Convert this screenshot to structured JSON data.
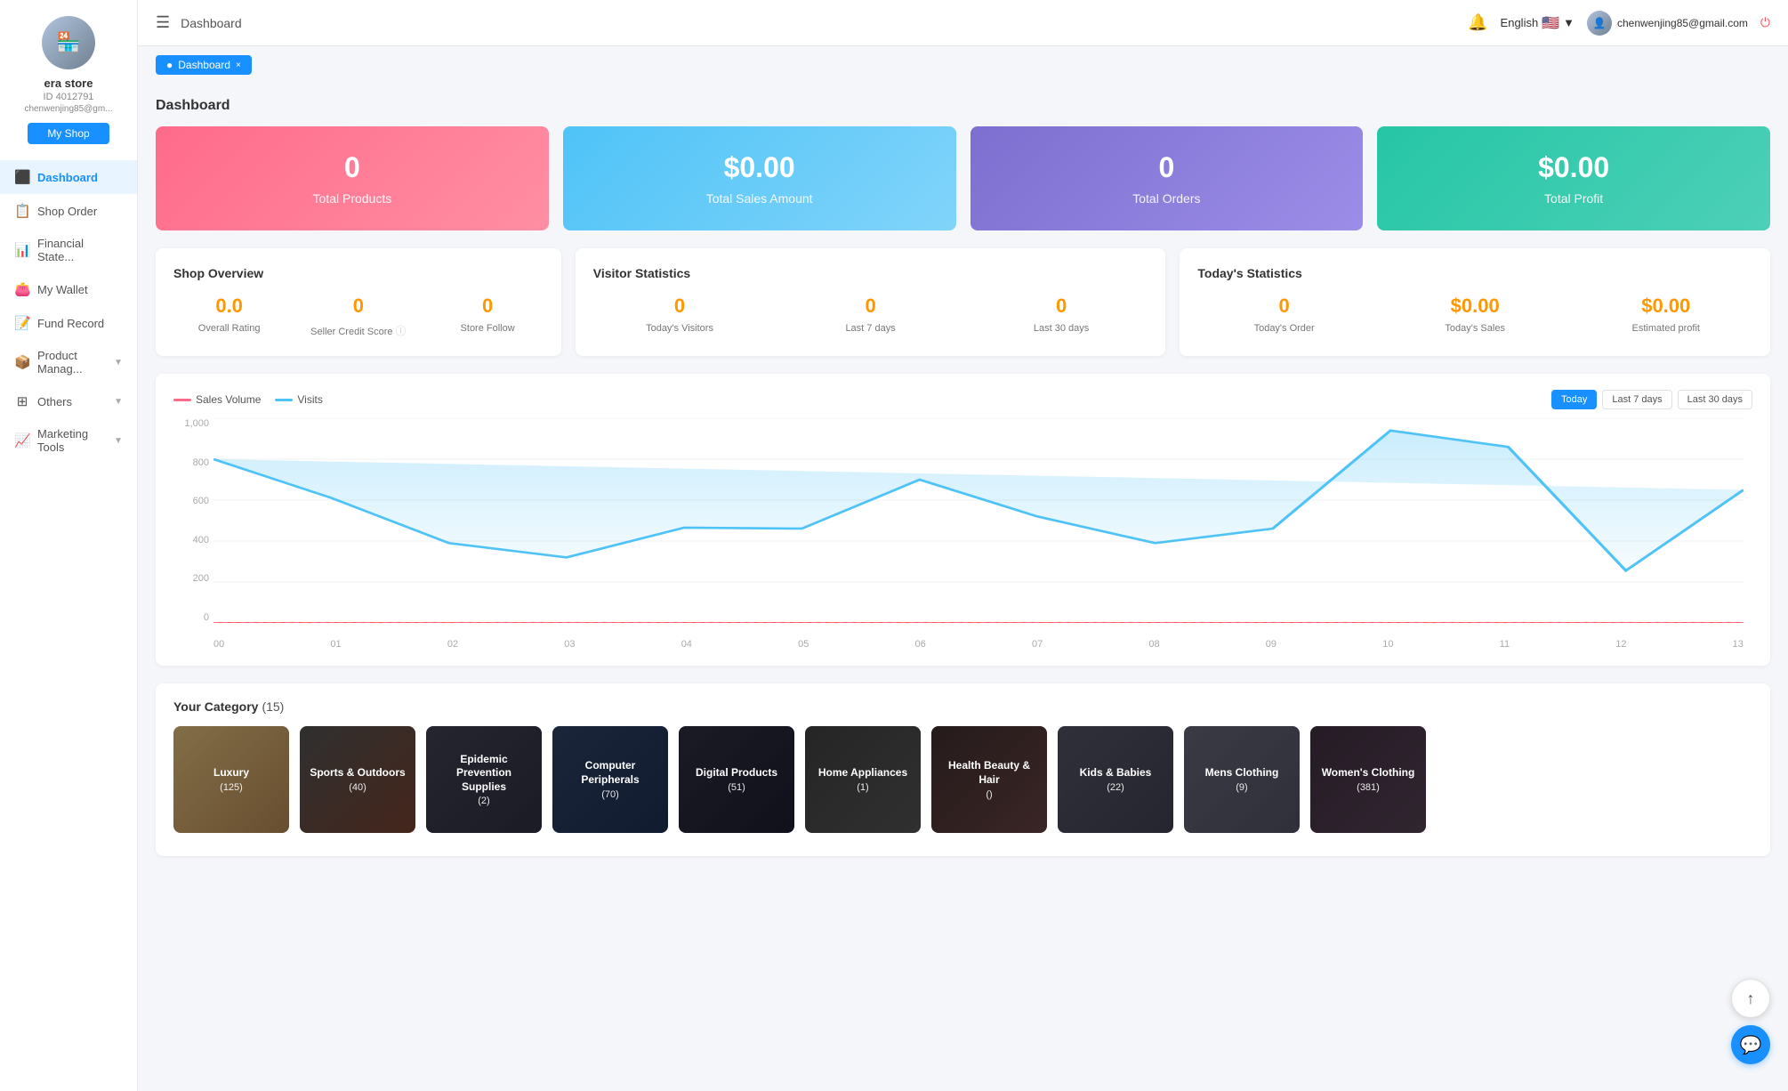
{
  "sidebar": {
    "store_name": "era store",
    "store_id": "ID 4012791",
    "store_email": "chenwenjing85@gm...",
    "my_shop_label": "My Shop",
    "avatar_icon": "🏪",
    "nav_items": [
      {
        "id": "dashboard",
        "label": "Dashboard",
        "icon": "⬛",
        "active": true,
        "has_children": false
      },
      {
        "id": "shop-order",
        "label": "Shop Order",
        "icon": "📋",
        "active": false,
        "has_children": false
      },
      {
        "id": "financial-state",
        "label": "Financial State...",
        "icon": "📊",
        "active": false,
        "has_children": false
      },
      {
        "id": "my-wallet",
        "label": "My Wallet",
        "icon": "👛",
        "active": false,
        "has_children": false
      },
      {
        "id": "fund-record",
        "label": "Fund Record",
        "icon": "📝",
        "active": false,
        "has_children": false
      },
      {
        "id": "product-manag",
        "label": "Product Manag...",
        "icon": "📦",
        "active": false,
        "has_children": true
      },
      {
        "id": "others",
        "label": "Others",
        "icon": "⊞",
        "active": false,
        "has_children": true
      },
      {
        "id": "marketing-tools",
        "label": "Marketing Tools",
        "icon": "📈",
        "active": false,
        "has_children": true
      }
    ]
  },
  "topbar": {
    "title": "Dashboard",
    "language": "English",
    "user_email": "chenwenjing85@gmail.com"
  },
  "breadcrumb": {
    "label": "Dashboard",
    "close_icon": "×"
  },
  "dashboard": {
    "title": "Dashboard"
  },
  "stats": {
    "cards": [
      {
        "id": "total-products",
        "value": "0",
        "label": "Total Products",
        "color_class": "stat-card-pink"
      },
      {
        "id": "total-sales",
        "value": "$0.00",
        "label": "Total Sales Amount",
        "color_class": "stat-card-blue"
      },
      {
        "id": "total-orders",
        "value": "0",
        "label": "Total Orders",
        "color_class": "stat-card-purple"
      },
      {
        "id": "total-profit",
        "value": "$0.00",
        "label": "Total Profit",
        "color_class": "stat-card-teal"
      }
    ]
  },
  "shop_overview": {
    "title": "Shop Overview",
    "stats": [
      {
        "id": "overall-rating",
        "value": "0.0",
        "label": "Overall Rating"
      },
      {
        "id": "seller-credit",
        "value": "0",
        "label": "Seller Credit Score",
        "has_info": true
      },
      {
        "id": "store-follow",
        "value": "0",
        "label": "Store Follow"
      }
    ]
  },
  "visitor_stats": {
    "title": "Visitor Statistics",
    "stats": [
      {
        "id": "todays-visitors",
        "value": "0",
        "label": "Today's Visitors"
      },
      {
        "id": "last-7-days",
        "value": "0",
        "label": "Last 7 days"
      },
      {
        "id": "last-30-days",
        "value": "0",
        "label": "Last 30 days"
      }
    ]
  },
  "todays_stats": {
    "title": "Today's Statistics",
    "stats": [
      {
        "id": "todays-order",
        "value": "0",
        "label": "Today's Order"
      },
      {
        "id": "todays-sales",
        "value": "$0.00",
        "label": "Today's Sales",
        "is_money": true
      },
      {
        "id": "estimated-profit",
        "value": "$0.00",
        "label": "Estimated profit",
        "is_money": true
      }
    ]
  },
  "chart": {
    "legend_sales": "Sales Volume",
    "legend_visits": "Visits",
    "btn_today": "Today",
    "btn_last7": "Last 7 days",
    "btn_last30": "Last 30 days",
    "y_labels": [
      "1,000",
      "800",
      "600",
      "400",
      "200",
      "0"
    ],
    "x_labels": [
      "00",
      "01",
      "02",
      "03",
      "04",
      "05",
      "06",
      "07",
      "08",
      "09",
      "10",
      "11",
      "12",
      "13"
    ],
    "visits_points": [
      [
        0,
        800
      ],
      [
        1,
        680
      ],
      [
        2,
        390
      ],
      [
        3,
        320
      ],
      [
        4,
        470
      ],
      [
        5,
        465
      ],
      [
        6,
        650
      ],
      [
        7,
        520
      ],
      [
        8,
        390
      ],
      [
        9,
        465
      ],
      [
        10,
        1050
      ],
      [
        11,
        980
      ],
      [
        12,
        260
      ],
      [
        13,
        650
      ]
    ]
  },
  "categories": {
    "title": "Your Category",
    "count": "(15)",
    "items": [
      {
        "id": "luxury",
        "name": "Luxury",
        "count": "(125)",
        "bg_class": "cat-bg-luxury"
      },
      {
        "id": "sports-outdoors",
        "name": "Sports & Outdoors",
        "count": "(40)",
        "bg_class": "cat-bg-sports"
      },
      {
        "id": "epidemic-prevention",
        "name": "Epidemic Prevention Supplies",
        "count": "(2)",
        "bg_class": "cat-bg-epidemic"
      },
      {
        "id": "computer-peripherals",
        "name": "Computer Peripherals",
        "count": "(70)",
        "bg_class": "cat-bg-computer"
      },
      {
        "id": "digital-products",
        "name": "Digital Products",
        "count": "(51)",
        "bg_class": "cat-bg-digital"
      },
      {
        "id": "home-appliances",
        "name": "Home Appliances",
        "count": "(1)",
        "bg_class": "cat-bg-home"
      },
      {
        "id": "health-beauty-hair",
        "name": "Health Beauty & Hair",
        "count": "()",
        "bg_class": "cat-bg-health"
      },
      {
        "id": "kids-babies",
        "name": "Kids & Babies",
        "count": "(22)",
        "bg_class": "cat-bg-kids"
      },
      {
        "id": "mens-clothing",
        "name": "Mens Clothing",
        "count": "(9)",
        "bg_class": "cat-bg-mens"
      },
      {
        "id": "womens-clothing",
        "name": "Women's Clothing",
        "count": "(381)",
        "bg_class": "cat-bg-womens"
      }
    ]
  }
}
